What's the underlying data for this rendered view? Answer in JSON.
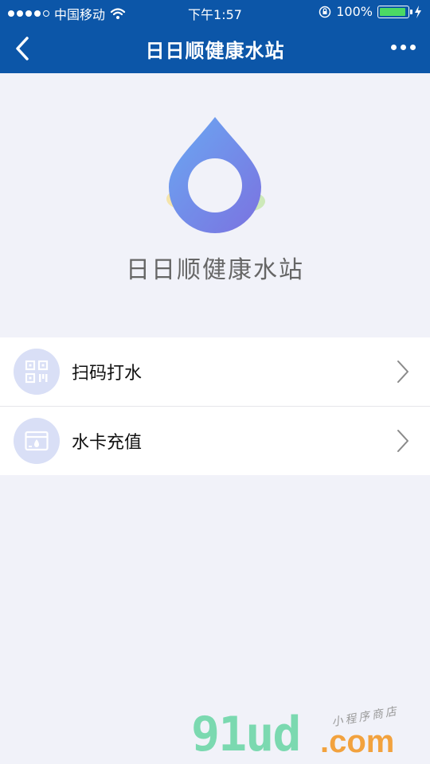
{
  "status_bar": {
    "carrier": "中国移动",
    "time": "下午1:57",
    "battery": "100%"
  },
  "nav": {
    "title": "日日顺健康水站"
  },
  "brand": {
    "name": "日日顺健康水站"
  },
  "menu": {
    "items": [
      {
        "label": "扫码打水",
        "icon": "qr-code-icon"
      },
      {
        "label": "水卡充值",
        "icon": "water-card-icon"
      }
    ]
  },
  "watermark": {
    "main": "91ud",
    "suffix": ".com",
    "tagline": "小程序商店"
  },
  "colors": {
    "nav_bg": "#0c56a8",
    "page_bg": "#f1f2f9",
    "icon_circle": "#d9dff6",
    "battery_green": "#4cd964"
  }
}
